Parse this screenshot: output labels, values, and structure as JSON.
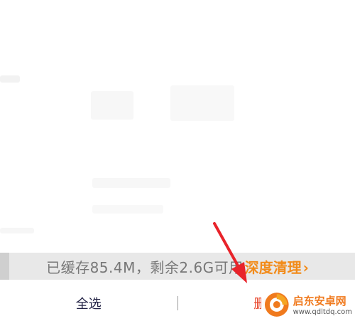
{
  "storage": {
    "status_text": "已缓存85.4M，剩余2.6G可用",
    "deep_clean_label": "深度清理",
    "chevron": "›"
  },
  "bottom_bar": {
    "select_all_label": "全选",
    "delete_label": "删除"
  },
  "watermark": {
    "title": "启东安卓网",
    "url": "www.qdltdq.com"
  },
  "colors": {
    "accent_orange": "#f28b1a",
    "delete_red": "#e8492f",
    "arrow_red": "#e8232a"
  }
}
